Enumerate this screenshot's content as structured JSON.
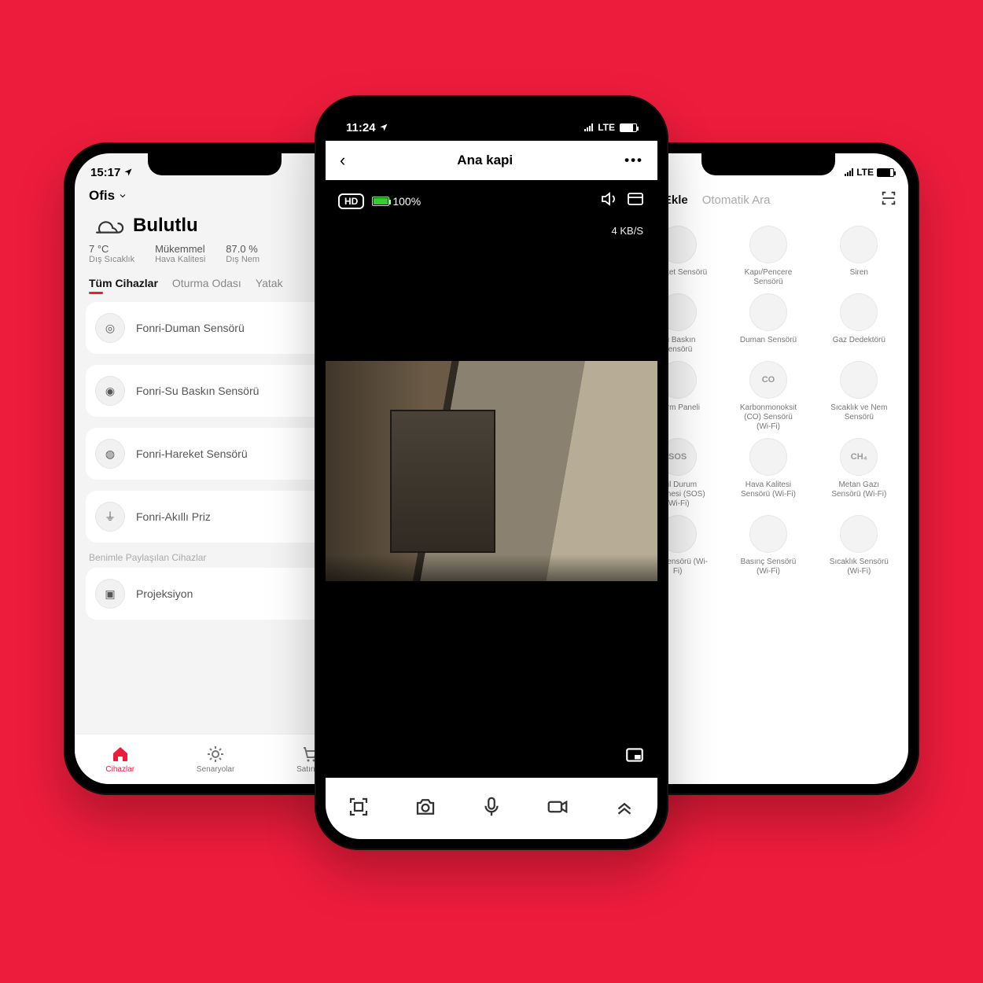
{
  "left": {
    "status_time": "15:17",
    "location_title": "Ofis",
    "weather_desc": "Bulutlu",
    "metrics": {
      "temp": "7 °C",
      "temp_lbl": "Dış Sıcaklık",
      "air": "Mükemmel",
      "air_lbl": "Hava Kalitesi",
      "hum": "87.0 %",
      "hum_lbl": "Dış Nem"
    },
    "room_tabs": {
      "active": "Tüm Cihazlar",
      "second": "Oturma Odası",
      "third": "Yatak"
    },
    "devices": [
      "Fonri-Duman Sensörü",
      "Fonri-Su Baskın Sensörü",
      "Fonri-Hareket Sensörü",
      "Fonri-Akıllı Priz"
    ],
    "shared_header": "Benimle Paylaşılan Cihazlar",
    "shared_device": "Projeksiyon",
    "bottom_nav": {
      "devices": "Cihazlar",
      "scenarios": "Senaryolar",
      "buy": "Satın Al"
    }
  },
  "center": {
    "status_time": "11:24",
    "net_label": "LTE",
    "header_title": "Ana kapi",
    "hd_label": "HD",
    "battery_pct": "100%",
    "bitrate": "4 KB/S"
  },
  "right": {
    "net_label": "LTE",
    "tabs": {
      "active": "Elle Ekle",
      "inactive": "Otomatik Ara"
    },
    "items": [
      {
        "name": "Hareket Sensörü",
        "badge": ""
      },
      {
        "name": "Kapı/Pencere Sensörü",
        "badge": ""
      },
      {
        "name": "Siren",
        "badge": ""
      },
      {
        "name": "Su Baskın Sensörü",
        "badge": ""
      },
      {
        "name": "Duman Sensörü",
        "badge": ""
      },
      {
        "name": "Gaz Dedektörü",
        "badge": ""
      },
      {
        "name": "Alarm Paneli",
        "badge": ""
      },
      {
        "name": "Karbonmonoksit (CO) Sensörü (Wi-Fi)",
        "badge": "CO"
      },
      {
        "name": "Sıcaklık ve Nem Sensörü",
        "badge": ""
      },
      {
        "name": "Acil Durum Düğmesi (SOS) (Wi-Fi)",
        "badge": "SOS"
      },
      {
        "name": "Hava Kalitesi Sensörü (Wi-Fi)",
        "badge": ""
      },
      {
        "name": "Metan Gazı Sensörü (Wi-Fi)",
        "badge": "CH₄"
      },
      {
        "name": "Işık Sensörü (Wi-Fi)",
        "badge": ""
      },
      {
        "name": "Basınç Sensörü (Wi-Fi)",
        "badge": ""
      },
      {
        "name": "Sıcaklık Sensörü (Wi-Fi)",
        "badge": ""
      }
    ]
  }
}
